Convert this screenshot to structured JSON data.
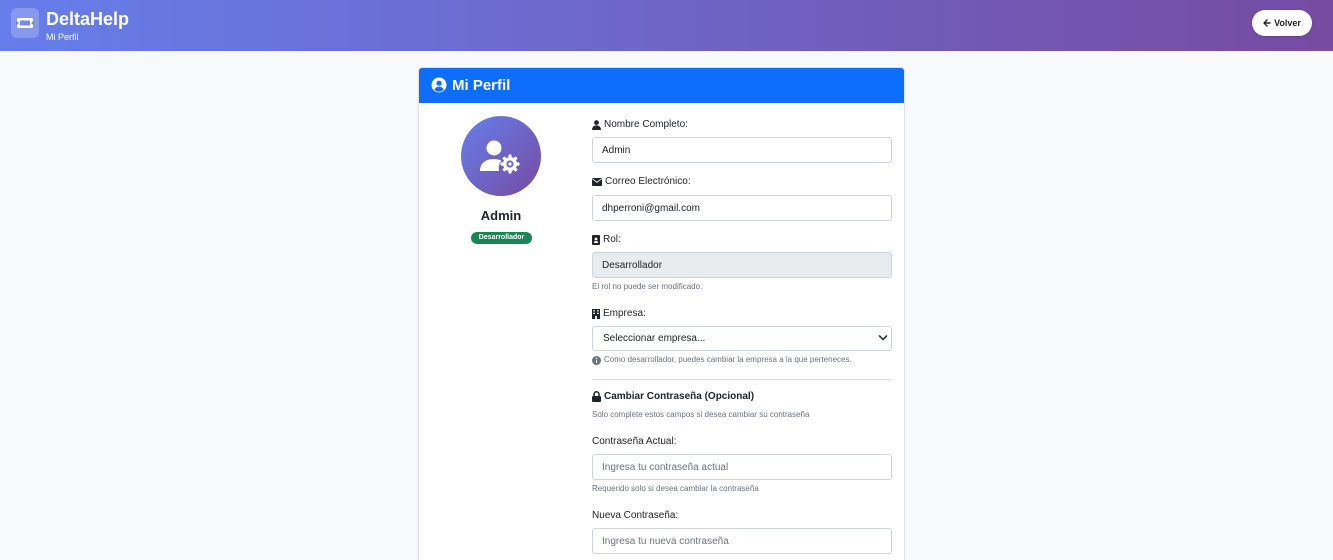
{
  "header": {
    "title": "DeltaHelp",
    "subtitle": "Mi Perfil",
    "back_label": "Volver"
  },
  "card": {
    "title": "Mi Perfil"
  },
  "profile": {
    "name": "Admin",
    "badge": "Desarrollador"
  },
  "form": {
    "full_name": {
      "label": "Nombre Completo:",
      "value": "Admin"
    },
    "email": {
      "label": "Correo Electrónico:",
      "value": "dhperroni@gmail.com"
    },
    "role": {
      "label": "Rol:",
      "value": "Desarrollador",
      "help": "El rol no puede ser modificado."
    },
    "company": {
      "label": "Empresa:",
      "selected": "Seleccionar empresa...",
      "help": "Como desarrollador, puedes cambiar la empresa a la que perteneces."
    },
    "password_section": {
      "title": "Cambiar Contraseña (Opcional)",
      "subtitle": "Solo complete estos campos si desea cambiar su contraseña"
    },
    "current_password": {
      "label": "Contraseña Actual:",
      "placeholder": "Ingresa tu contraseña actual",
      "help": "Requerido solo si desea cambiar la contraseña"
    },
    "new_password": {
      "label": "Nueva Contraseña:",
      "placeholder": "Ingresa tu nueva contraseña"
    }
  },
  "colors": {
    "header_gradient_start": "#667eea",
    "header_gradient_end": "#764ba2",
    "card_header": "#0d6efd",
    "badge": "#198754"
  },
  "icons": [
    "ticket-icon",
    "arrow-left-icon",
    "user-circle-icon",
    "user-gear-icon",
    "user-icon",
    "envelope-icon",
    "id-badge-icon",
    "building-icon",
    "chevron-down-icon",
    "info-circle-icon",
    "lock-icon"
  ]
}
